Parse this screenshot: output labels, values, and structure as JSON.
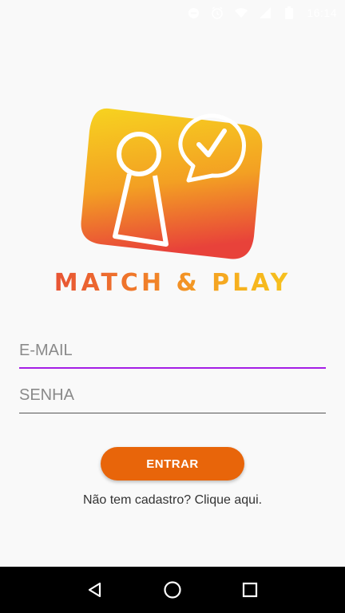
{
  "status_bar": {
    "time": "16:14",
    "icons": [
      "do-not-disturb-icon",
      "alarm-icon",
      "wifi-icon",
      "signal-icon",
      "battery-icon"
    ]
  },
  "logo": {
    "icon": "pawn-chat-check-icon",
    "colors": {
      "top": "#f7d320",
      "bottom": "#e8423a",
      "accent": "#ffffff"
    }
  },
  "app_name": "MATCH & PLAY",
  "form": {
    "email_placeholder": "E-MAIL",
    "email_value": "",
    "password_placeholder": "SENHA",
    "password_value": ""
  },
  "buttons": {
    "enter_label": "ENTRAR"
  },
  "signup_text": "Não tem cadastro? Clique aqui.",
  "colors": {
    "primary": "#e8650a",
    "focus_underline": "#a51ee6",
    "background": "#f9f9f9"
  },
  "nav_bar": {
    "icons": [
      "back-icon",
      "home-icon",
      "recents-icon"
    ]
  }
}
